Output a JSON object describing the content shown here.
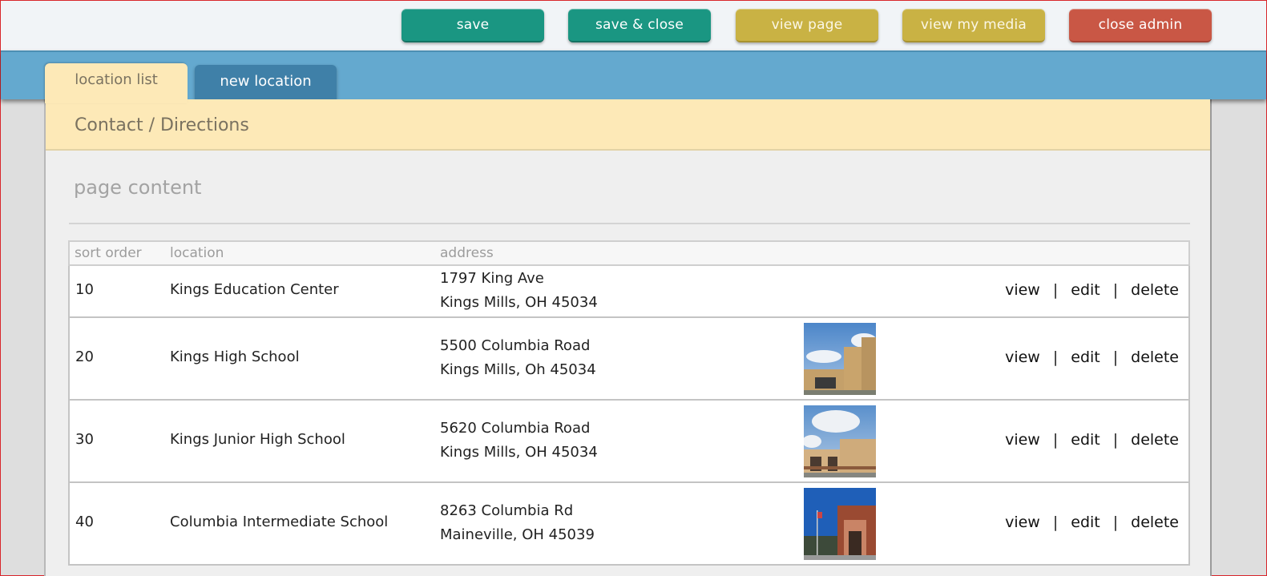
{
  "toolbar": {
    "buttons": [
      {
        "label": "save",
        "color": "#1a9682"
      },
      {
        "label": "save & close",
        "color": "#1a9682"
      },
      {
        "label": "view page",
        "color": "#c9b244"
      },
      {
        "label": "view my media",
        "color": "#c9b244"
      },
      {
        "label": "close admin",
        "color": "#c95745"
      }
    ]
  },
  "tabs": [
    {
      "label": "location list",
      "active": true
    },
    {
      "label": "new location",
      "active": false
    }
  ],
  "page": {
    "title": "Contact / Directions",
    "section_title": "page content"
  },
  "table": {
    "columns": [
      "sort order",
      "location",
      "address",
      "",
      ""
    ],
    "action_labels": {
      "view": "view",
      "edit": "edit",
      "delete": "delete",
      "separator": "|"
    },
    "rows": [
      {
        "sort": "10",
        "location": "Kings Education Center",
        "address1": "1797 King Ave",
        "address2": "Kings Mills, OH 45034",
        "image": null
      },
      {
        "sort": "20",
        "location": "Kings High School",
        "address1": "5500 Columbia Road",
        "address2": "Kings Mills, Oh 45034",
        "image": "school-building-photo"
      },
      {
        "sort": "30",
        "location": "Kings Junior High School",
        "address1": "5620 Columbia Road",
        "address2": "Kings Mills, OH 45034",
        "image": "school-building-photo"
      },
      {
        "sort": "40",
        "location": "Columbia Intermediate School",
        "address1": "8263 Columbia Rd",
        "address2": "Maineville, OH 45039",
        "image": "school-building-photo"
      }
    ]
  }
}
